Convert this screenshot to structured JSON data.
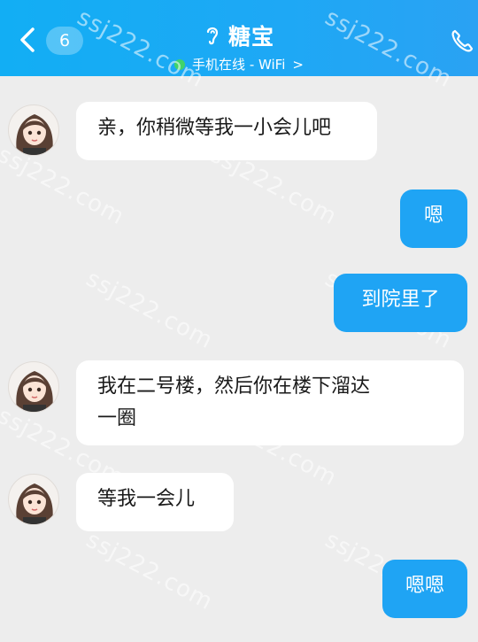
{
  "header": {
    "back_icon": "chevron-left-icon",
    "unread_count": "6",
    "contact_name": "糖宝",
    "status_text": "手机在线 - WiFi",
    "status_arrow": ">",
    "status_color": "#41d36a",
    "accent_color": "#1fa4f4"
  },
  "messages": [
    {
      "side": "in",
      "text": "亲，你稍微等我一小会儿吧"
    },
    {
      "side": "out",
      "text": "嗯"
    },
    {
      "side": "out",
      "text": "到院里了"
    },
    {
      "side": "in",
      "line1": "我在二号楼，然后你在楼下溜达",
      "line2": "一圈"
    },
    {
      "side": "in",
      "text": "等我一会儿"
    },
    {
      "side": "out",
      "text": "嗯嗯"
    }
  ],
  "watermark": "ssj222.com"
}
